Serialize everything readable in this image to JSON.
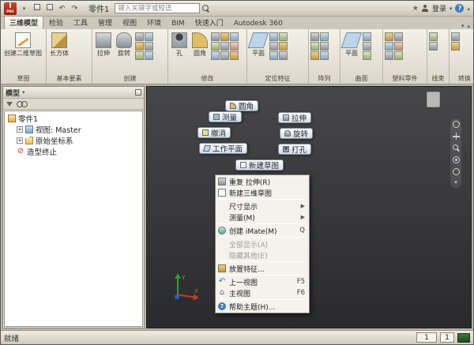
{
  "titlebar": {
    "logo_text": "I",
    "logo_sub": "PRO",
    "doc_title": "零件1",
    "search_placeholder": "键入关键字或短语",
    "sign_in_label": "登录"
  },
  "icons": {
    "dropdown": "▾",
    "chevron_up": "▴",
    "submenu": "▶",
    "help": "?",
    "plus": "+",
    "undo": "↶",
    "redo": "↷",
    "star": "★",
    "no_entry": "⊘",
    "prev_view": "↶",
    "home": "⌂"
  },
  "ribbon": {
    "tabs": [
      {
        "label": "三维模型"
      },
      {
        "label": "检验"
      },
      {
        "label": "工具"
      },
      {
        "label": "管理"
      },
      {
        "label": "视图"
      },
      {
        "label": "环境"
      },
      {
        "label": "BIM"
      },
      {
        "label": "快速入门"
      },
      {
        "label": "Autodesk 360"
      }
    ],
    "panels": {
      "sketch": {
        "label": "草图",
        "button": "创建二维草图"
      },
      "primitives": {
        "label": "基本要素",
        "button": "长方体"
      },
      "create": {
        "label": "创建",
        "b1": "拉伸",
        "b2": "旋转"
      },
      "modify": {
        "label": "修改",
        "b1": "孔",
        "b2": "圆角"
      },
      "work": {
        "label": "定位特征",
        "button": "平面"
      },
      "pattern": {
        "label": "阵列"
      },
      "surface": {
        "label": "曲面",
        "button": "平面"
      },
      "plastic": {
        "label": "塑料零件"
      },
      "harness": {
        "label": "线束"
      },
      "convert": {
        "label": "转换"
      }
    }
  },
  "browser": {
    "title": "模型",
    "tree": [
      {
        "label": "零件1"
      },
      {
        "label": "视图: Master"
      },
      {
        "label": "原始坐标系"
      },
      {
        "label": "造型终止"
      }
    ]
  },
  "canvas": {
    "marking_menu": [
      {
        "label": "圆角"
      },
      {
        "label": "测量"
      },
      {
        "label": "拉伸"
      },
      {
        "label": "撤消"
      },
      {
        "label": "旋转"
      },
      {
        "label": "工作平面"
      },
      {
        "label": "打孔"
      },
      {
        "label": "新建草图"
      }
    ],
    "context_menu": [
      {
        "label": "重复 拉伸(R)"
      },
      {
        "label": "新建三维草图"
      },
      {
        "label": "尺寸显示"
      },
      {
        "label": "测量(M)"
      },
      {
        "label": "创建 iMate(M)",
        "shortcut": "Q"
      },
      {
        "label": "全部显示(A)"
      },
      {
        "label": "隐藏其他(E)"
      },
      {
        "label": "放置特征..."
      },
      {
        "label": "上一视图",
        "shortcut": "F5"
      },
      {
        "label": "主视图",
        "shortcut": "F6"
      },
      {
        "label": "帮助主题(H)..."
      }
    ]
  },
  "statusbar": {
    "ready": "就绪",
    "counter1": "1",
    "counter2": "1"
  },
  "colors": {
    "accent_red": "#c23b2a",
    "canvas_dark": "#2a2a2c"
  }
}
